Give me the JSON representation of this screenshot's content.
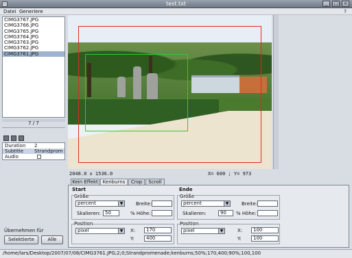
{
  "window": {
    "title": "test.txt",
    "minimize": "_",
    "maximize": "□",
    "close": "×"
  },
  "menu": {
    "file": "Datei",
    "generate": "Generiere",
    "help": "?"
  },
  "files": [
    "CIMG3767.JPG",
    "CIMG3766.JPG",
    "CIMG3765.JPG",
    "CIMG3764.JPG",
    "CIMG3763.JPG",
    "CIMG3762.JPG",
    "CIMG3761.JPG"
  ],
  "selected_file_index": 6,
  "counter": "7 / 7",
  "properties": [
    {
      "key": "Duration",
      "value": "2"
    },
    {
      "key": "Subtitle",
      "value": "Strandprom"
    },
    {
      "key": "Audio",
      "value": ""
    }
  ],
  "apply": {
    "label": "Übernehmen für",
    "selected": "Selektierte",
    "all": "Alle"
  },
  "image": {
    "size": "2048.0 x 1536.0",
    "coords": "X=  600 ; Y=  973"
  },
  "tabs": [
    "Kein Effekt",
    "Kenburns",
    "Crop",
    "Scroll"
  ],
  "active_tab": "Kenburns",
  "effect": {
    "start": {
      "title": "Start",
      "size_label": "Größe",
      "size_unit": "percent",
      "width_label": "Breite:",
      "width_value": "",
      "scale_label": "Skalieren:",
      "scale_value": "50",
      "height_label": "% Höhe:",
      "height_value": "",
      "position_label": "Position",
      "position_unit": "pixel",
      "x_label": "X:",
      "x_value": "170",
      "y_label": "Y:",
      "y_value": "400"
    },
    "end": {
      "title": "Ende",
      "size_label": "Größe",
      "size_unit": "percent",
      "width_label": "Breite:",
      "width_value": "",
      "scale_label": "Skalieren:",
      "scale_value": "90",
      "height_label": "% Höhe:",
      "height_value": "",
      "position_label": "Position",
      "position_unit": "pixel",
      "x_label": "X:",
      "x_value": "100",
      "y_label": "Y:",
      "y_value": "100"
    }
  },
  "status": "/home/lars/Desktop/2007/07/08/CIMG3761.JPG;2;0;Strandpromenade;kenburns;50%;170,400;90%;100,100",
  "colors": {
    "start_rect": "#e0291f",
    "end_rect": "#32c832",
    "selection": "#9db3cf"
  }
}
